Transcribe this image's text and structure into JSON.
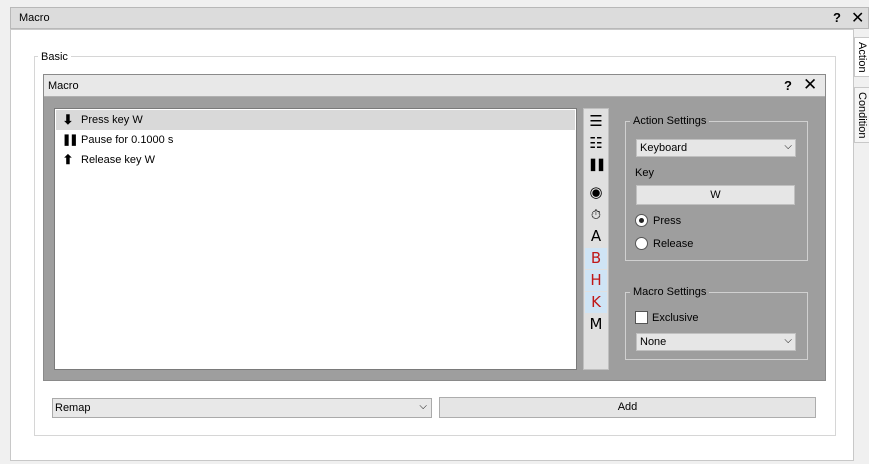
{
  "outer_window": {
    "title": "Macro",
    "help_label": "?",
    "close_label": "✕"
  },
  "side_tabs": [
    {
      "label": "Action"
    },
    {
      "label": "Condition"
    }
  ],
  "basic_group": {
    "legend": "Basic"
  },
  "inner_window": {
    "title": "Macro",
    "help_label": "?",
    "close_label": "✕"
  },
  "action_list": {
    "items": [
      {
        "icon": "arrow-down-icon",
        "glyph": "⬇",
        "label": "Press key W",
        "selected": true
      },
      {
        "icon": "pause-icon",
        "glyph": "❚❚",
        "label": "Pause for 0.1000 s",
        "selected": false
      },
      {
        "icon": "arrow-up-icon",
        "glyph": "⬆",
        "label": "Release key W",
        "selected": false
      }
    ]
  },
  "toolbar": {
    "buttons": [
      {
        "name": "list-add-icon",
        "glyph": "☰"
      },
      {
        "name": "list-remove-icon",
        "glyph": "☷"
      },
      {
        "name": "pause-icon",
        "glyph": "❚❚"
      },
      {
        "name": "record-icon",
        "glyph": "◉"
      },
      {
        "name": "timer-icon",
        "glyph": "⏱"
      },
      {
        "name": "letter-a-button",
        "glyph": "A"
      },
      {
        "name": "letter-b-button",
        "glyph": "B"
      },
      {
        "name": "letter-h-button",
        "glyph": "H"
      },
      {
        "name": "letter-k-button",
        "glyph": "K"
      },
      {
        "name": "letter-m-button",
        "glyph": "M"
      }
    ],
    "active_color": "#c01818",
    "active_bg": "#cfe4f5"
  },
  "action_settings": {
    "legend": "Action Settings",
    "type_value": "Keyboard",
    "key_label": "Key",
    "key_value": "W",
    "radio_press": "Press",
    "radio_release": "Release",
    "selected_radio": "Press"
  },
  "macro_settings": {
    "legend": "Macro Settings",
    "exclusive_label": "Exclusive",
    "exclusive_checked": false,
    "mode_value": "None"
  },
  "bottom_bar": {
    "remap_value": "Remap",
    "add_label": "Add"
  }
}
